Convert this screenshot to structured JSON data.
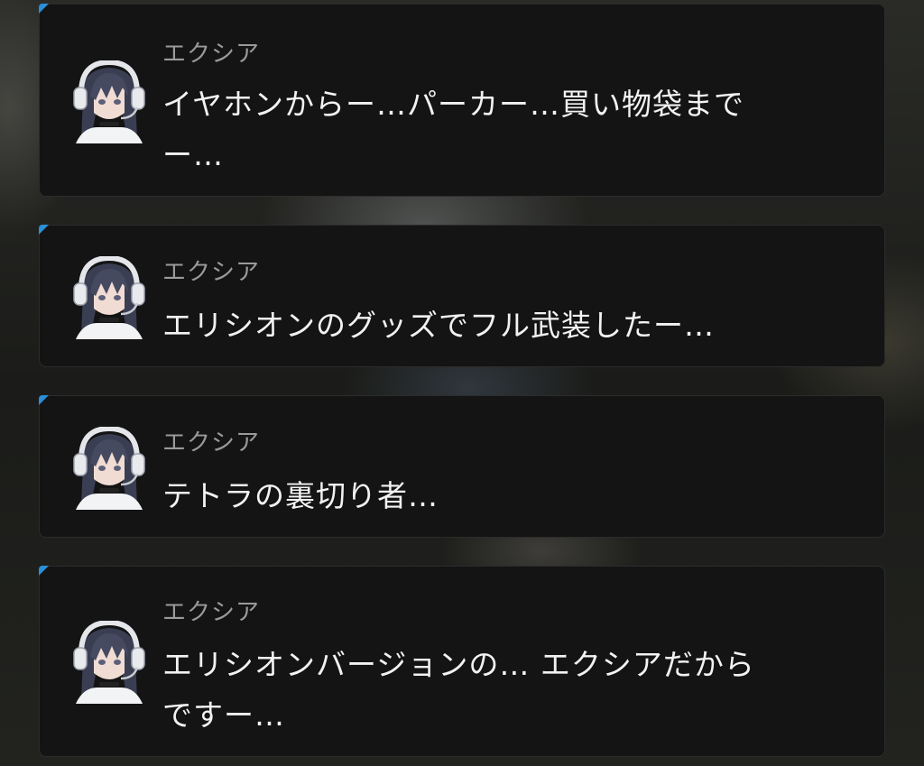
{
  "messages": [
    {
      "speaker": "エクシア",
      "lines": [
        "イヤホンからー…パーカー…買い物袋まで",
        "ー…"
      ]
    },
    {
      "speaker": "エクシア",
      "lines": [
        "エリシオンのグッズでフル武装したー…"
      ]
    },
    {
      "speaker": "エクシア",
      "lines": [
        "テトラの裏切り者…"
      ]
    },
    {
      "speaker": "エクシア",
      "lines": [
        "エリシオンバージョンの… エクシアだから",
        "ですー…"
      ]
    }
  ],
  "colors": {
    "card_bg": "#141414",
    "accent_corner": "#2a8fd9",
    "speaker_text": "#9a9a9a",
    "message_text": "#f2f2f2"
  }
}
